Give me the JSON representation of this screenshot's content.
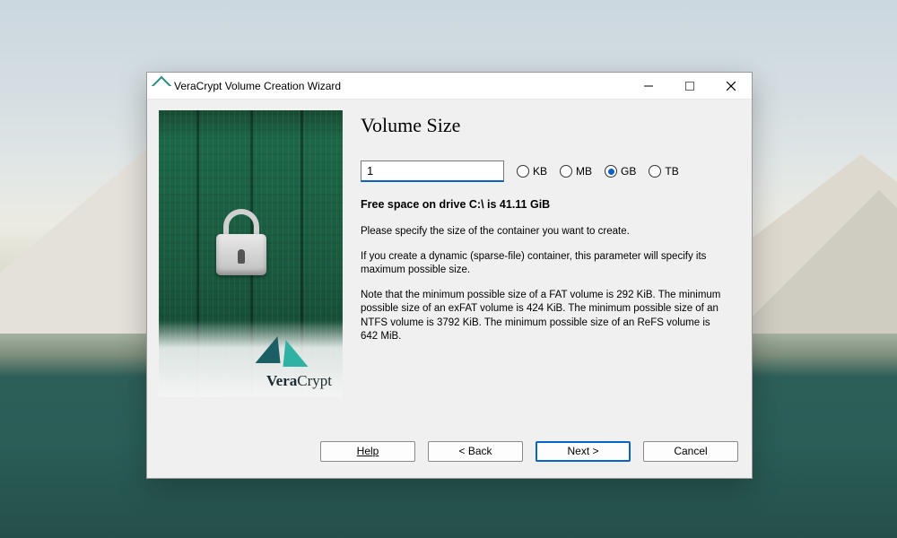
{
  "window": {
    "title": "VeraCrypt Volume Creation Wizard"
  },
  "brand": {
    "name_bold": "Vera",
    "name_rest": "Crypt"
  },
  "page": {
    "heading": "Volume Size",
    "size_value": "1",
    "units": {
      "kb": "KB",
      "mb": "MB",
      "gb": "GB",
      "tb": "TB",
      "selected": "gb"
    },
    "free_space": "Free space on drive C:\\ is 41.11 GiB",
    "para1": "Please specify the size of the container you want to create.",
    "para2": "If you create a dynamic (sparse-file) container, this parameter will specify its maximum possible size.",
    "para3": "Note that the minimum possible size of a FAT volume is 292 KiB. The minimum possible size of an exFAT volume is 424 KiB. The minimum possible size of an NTFS volume is 3792 KiB. The minimum possible size of an ReFS volume is 642 MiB."
  },
  "footer": {
    "help": "Help",
    "back": "< Back",
    "next": "Next >",
    "cancel": "Cancel"
  }
}
